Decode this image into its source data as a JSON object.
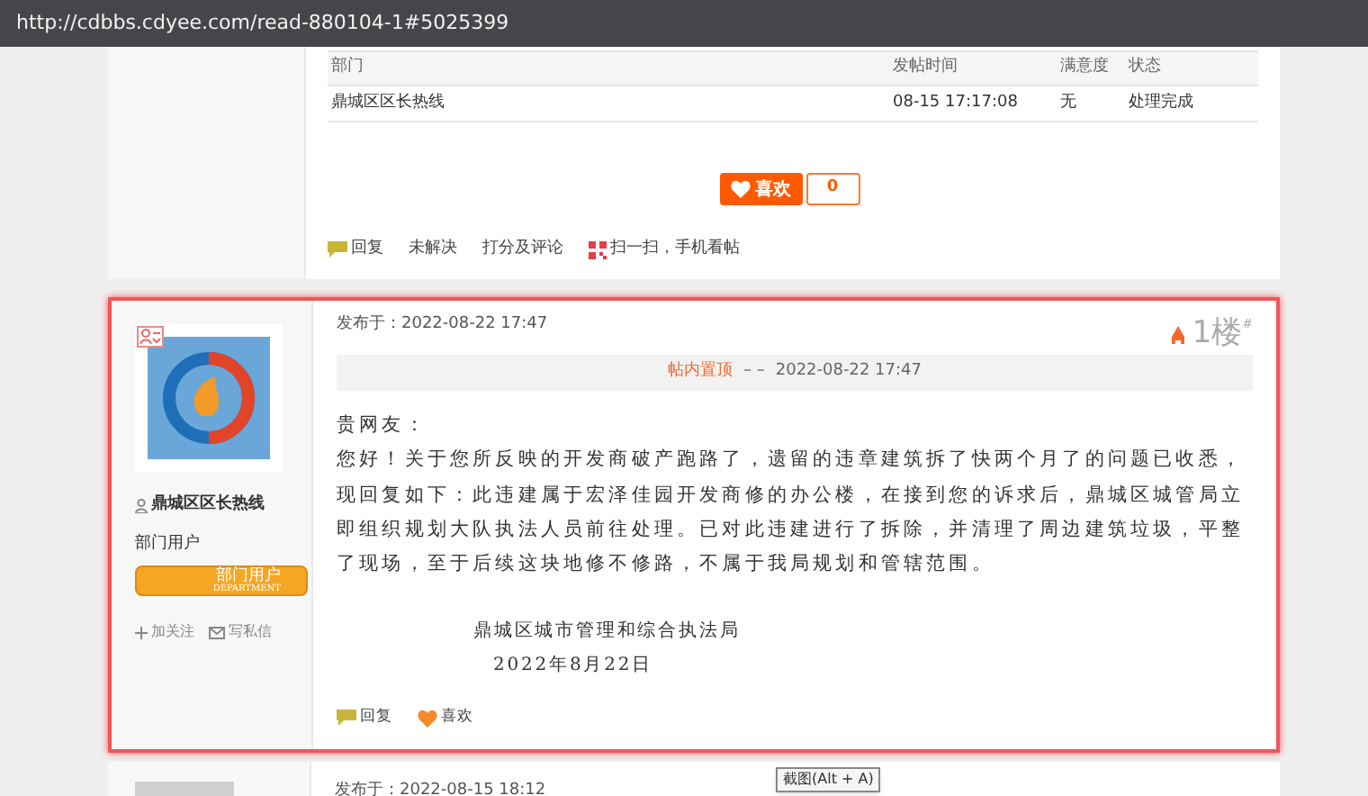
{
  "address_bar": {
    "url": "http://cdbbs.cdyee.com/read-880104-1#5025399"
  },
  "previous_post": {
    "table": {
      "columns": [
        "部门",
        "发帖时间",
        "满意度",
        "状态"
      ],
      "rows": [
        [
          "鼎城区区长热线",
          "08-15 17:17:08",
          "无",
          "处理完成"
        ]
      ]
    },
    "like_button": {
      "label": "喜欢",
      "count": "0"
    },
    "actions": [
      {
        "kind": "reply",
        "label": "回复"
      },
      {
        "kind": "plain",
        "label": "未解决"
      },
      {
        "kind": "plain",
        "label": "打分及评论"
      },
      {
        "kind": "qr",
        "label": "扫一扫，手机看帖"
      }
    ]
  },
  "post": {
    "highlighted": true,
    "author": {
      "name": "鼎城区区长热线",
      "group": "部门用户",
      "badge": {
        "title": "部门用户",
        "subtitle": "DEPARTMENT"
      },
      "links": [
        {
          "kind": "follow",
          "label": "加关注"
        },
        {
          "kind": "message",
          "label": "写私信"
        }
      ]
    },
    "posted": "发布于：2022-08-22 17:47",
    "floor": "1楼",
    "floor_mark": "#",
    "pinned": {
      "label": "帖内置顶",
      "by": "–  –",
      "time": "2022-08-22 17:47"
    },
    "body": [
      "贵网友：",
      "您好！关于您所反映的开发商破产跑路了，遗留的违章建筑拆了快两个月了的问题已收悉，现回复如下：此违建属于宏泽佳园开发商修的办公楼，在接到您的诉求后，鼎城区城管局立即组织规划大队执法人员前往处理。已对此违建进行了拆除，并清理了周边建筑垃圾，平整了现场，至于后续这块地修不修路，不属于我局规划和管辖范围。"
    ],
    "signature": [
      "鼎城区城市管理和综合执法局",
      "2022年8月22日"
    ],
    "actions": [
      {
        "kind": "reply",
        "label": "回复"
      },
      {
        "kind": "like",
        "label": "喜欢"
      }
    ]
  },
  "next_post": {
    "posted": "发布于：2022-08-15 18:12"
  },
  "tooltip": {
    "text": "截图(Alt + A)"
  }
}
